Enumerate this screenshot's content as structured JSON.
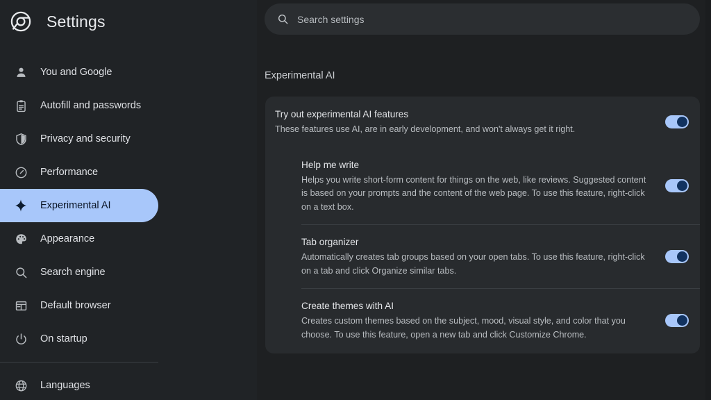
{
  "app": {
    "title": "Settings",
    "logo_icon": "chrome-logo-icon"
  },
  "search": {
    "placeholder": "Search settings",
    "value": "",
    "icon": "search-icon"
  },
  "sidebar": {
    "items": [
      {
        "label": "You and Google",
        "icon": "person-icon",
        "selected": false
      },
      {
        "label": "Autofill and passwords",
        "icon": "clipboard-icon",
        "selected": false
      },
      {
        "label": "Privacy and security",
        "icon": "shield-icon",
        "selected": false
      },
      {
        "label": "Performance",
        "icon": "speedometer-icon",
        "selected": false
      },
      {
        "label": "Experimental AI",
        "icon": "sparkle-icon",
        "selected": true
      },
      {
        "label": "Appearance",
        "icon": "palette-icon",
        "selected": false
      },
      {
        "label": "Search engine",
        "icon": "magnifier-icon",
        "selected": false
      },
      {
        "label": "Default browser",
        "icon": "browser-window-icon",
        "selected": false
      },
      {
        "label": "On startup",
        "icon": "power-icon",
        "selected": false
      },
      {
        "label": "Languages",
        "icon": "globe-icon",
        "selected": false
      }
    ],
    "divider_after_index": 8
  },
  "main": {
    "section_title": "Experimental AI",
    "primary_row": {
      "title": "Try out experimental AI features",
      "description": "These features use AI, are in early development, and won't always get it right.",
      "toggle_state": "on"
    },
    "sub_rows": [
      {
        "title": "Help me write",
        "description": "Helps you write short-form content for things on the web, like reviews. Suggested content is based on your prompts and the content of the web page. To use this feature, right-click on a text box.",
        "toggle_state": "on"
      },
      {
        "title": "Tab organizer",
        "description": "Automatically creates tab groups based on your open tabs. To use this feature, right-click on a tab and click Organize similar tabs.",
        "toggle_state": "on"
      },
      {
        "title": "Create themes with AI",
        "description": "Creates custom themes based on the subject, mood, visual style, and color that you choose. To use this feature, open a new tab and click Customize Chrome.",
        "toggle_state": "on"
      }
    ]
  },
  "colors": {
    "page_background": "#1e2022",
    "sidebar_background": "#202326",
    "card_background": "#282b2e",
    "accent_selected": "#a8c7fa",
    "toggle_knob": "#11325f",
    "text_primary": "#e3e5e8",
    "text_secondary": "#b9bdc1"
  }
}
